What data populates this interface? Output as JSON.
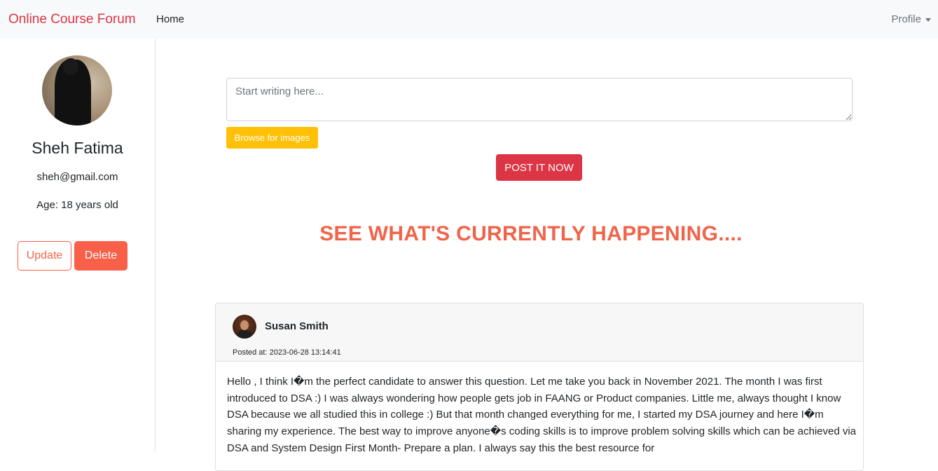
{
  "navbar": {
    "brand": "Online Course Forum",
    "home": "Home",
    "profile": "Profile"
  },
  "sidebar": {
    "name": "Sheh Fatima",
    "email": "sheh@gmail.com",
    "age": "Age: 18 years old",
    "update_label": "Update",
    "delete_label": "Delete"
  },
  "composer": {
    "placeholder": "Start writing here...",
    "value": "",
    "browse_label": "Browse for images",
    "post_label": "POST IT NOW"
  },
  "feed": {
    "headline": "SEE WHAT'S CURRENTLY HAPPENING....",
    "posts": [
      {
        "author": "Susan Smith",
        "posted_at": "Posted at: 2023-06-28 13:14:41",
        "body": "Hello , I think I�m the perfect candidate to answer this question. Let me take you back in November 2021. The month I was first introduced to DSA :) I was always wondering how people gets job in FAANG or Product companies. Little me, always thought I know DSA because we all studied this in college :) But that month changed everything for me, I started my DSA journey and here I�m sharing my experience. The best way to improve anyone�s coding skills is to improve problem solving skills which can be achieved via DSA and System Design First Month- Prepare a plan. I always say this the best resource for"
      }
    ]
  },
  "colors": {
    "brand": "#dc3545",
    "accent": "#f0644a",
    "warning": "#ffc107"
  },
  "icons": {
    "profile_caret": "caret-down-icon"
  }
}
